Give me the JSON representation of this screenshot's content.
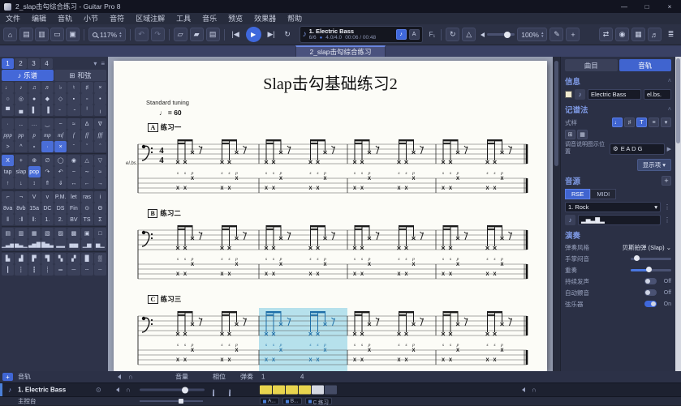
{
  "window": {
    "title": "2_slap击勾综合练习 - Guitar Pro 8",
    "min": "—",
    "max": "□",
    "close": "×"
  },
  "menu": {
    "items": [
      "文件",
      "编辑",
      "音轨",
      "小节",
      "音符",
      "区域注解",
      "工具",
      "音乐",
      "预览",
      "效果器",
      "帮助"
    ]
  },
  "toolbar": {
    "home": "⌂",
    "views": [
      "▤",
      "▥",
      "▭",
      "▣"
    ],
    "zoom": "117%",
    "up": "▴",
    "down": "▾",
    "undo": "↶",
    "redo": "↷",
    "doc1": "▱",
    "doc2": "▰",
    "print": "▤",
    "prev": "|◀",
    "play": "▶",
    "next": "▶|",
    "loop": "↻",
    "metronome": "△",
    "box": {
      "icon": "♪",
      "name": "1. Electric Bass",
      "pos": "6/6",
      "dot": "●",
      "sig": "4.0/4.0",
      "time": "00:06 / 00:48",
      "note_btn": "♪",
      "a_btn": "A"
    },
    "f1": "F₁",
    "vol": "100%",
    "pencil": "✎",
    "plus": "+",
    "right": [
      "⇄",
      "◉",
      "▦",
      "♬"
    ],
    "edge": "≣"
  },
  "tabbar": {
    "tab": "2_slap击勾综合练习"
  },
  "palette": {
    "tabs": [
      "1",
      "2",
      "3",
      "4"
    ],
    "caret": "▾",
    "menu_icon": "≡",
    "score_icon": "♪",
    "score_btn": "乐谱",
    "chord_icon": "⊞",
    "chord_btn": "和弦",
    "rows": [
      [
        "♩",
        "♪",
        "♫",
        "♬",
        "♭",
        "♮",
        "♯",
        "×"
      ],
      [
        "○",
        "◎",
        "●",
        "◆",
        "◇",
        "▪",
        "▫",
        "•"
      ],
      [
        "▀",
        "▄",
        "▌",
        "▐",
        "╴",
        "╶",
        "╵",
        "╷"
      ],
      [
        "·",
        "‥",
        "…",
        "‿",
        "~",
        "≈",
        "Δ",
        "∇"
      ],
      [
        "ppp",
        "pp",
        "p",
        "mp",
        "mf",
        "f",
        "ff",
        "fff"
      ],
      [
        ">",
        "^",
        "∘",
        "*·",
        "*×",
        "ˉ",
        "ˇ",
        "ˆ"
      ],
      [
        "*X",
        "+",
        "⊕",
        "∅",
        "◯",
        "◉",
        "△",
        "▽"
      ],
      [
        "tap",
        "slap",
        "*pop",
        "↷",
        "↶",
        "~",
        "∼",
        "≈"
      ],
      [
        "↑",
        "↓",
        "↕",
        "⇑",
        "⇓",
        "↔",
        "←",
        "→"
      ],
      [
        "⌐",
        "¬",
        "V",
        "v",
        "P.M.",
        "let",
        "ras",
        "i"
      ],
      [
        "8va",
        "8vb",
        "15a",
        "DC",
        "DS",
        "Fin",
        "⊙",
        "Θ"
      ],
      [
        "‖",
        ":‖",
        "‖:",
        "1.",
        "2.",
        "BV",
        "TS",
        "Σ"
      ],
      [
        "▤",
        "▥",
        "▦",
        "▧",
        "▨",
        "▩",
        "▣",
        "□"
      ],
      [
        "▁▃▅",
        "▅▃▁",
        "▃▅▇",
        "▇▅▃",
        "▂▂",
        "▅▅",
        "▁▅",
        "▅▁"
      ],
      [
        "▙",
        "▟",
        "▛",
        "▜",
        "▚",
        "▞",
        "█",
        "▒"
      ],
      [
        "┃",
        "┆",
        "┇",
        "┊",
        "═",
        "─",
        "┄",
        "┈"
      ]
    ]
  },
  "score": {
    "title": "Slap击勾基础练习2",
    "tuning": "Standard tuning",
    "tempo_note": "♩",
    "tempo_text": "= 60",
    "instrument": "el.bs.",
    "letters": [
      "S",
      "S",
      "P"
    ],
    "systems": [
      {
        "letter": "A",
        "name": "练习一",
        "measures": 4,
        "timesig": true,
        "highlight": []
      },
      {
        "letter": "B",
        "name": "练习二",
        "measures": 4,
        "timesig": false,
        "highlight": []
      },
      {
        "letter": "C",
        "name": "练习三",
        "measures": 4,
        "timesig": false,
        "highlight": [
          1
        ]
      }
    ]
  },
  "right_panel": {
    "tab_song": "曲目",
    "tab_track": "音轨",
    "info": {
      "header": "信息",
      "caret": "˄",
      "name": "Electric Bass",
      "short": "el.bs.",
      "icon": "♪"
    },
    "notation": {
      "header": "记谱法",
      "caret": "˄",
      "style": "式样",
      "style_btns": [
        "*♩",
        "♯",
        "*T",
        "≡",
        "▾"
      ],
      "extra_btns": [
        "⊞",
        "▦"
      ],
      "tuning_label": "调音说明图示位置",
      "gear": "⚙",
      "tuning": "E A D G",
      "arrow": "▶",
      "display": "显示项 ▾"
    },
    "audio": {
      "header": "音源",
      "plus": "+",
      "rse": "RSE",
      "midi": "MIDI",
      "bank": "1. Rock",
      "caret": "▾",
      "dots": "⋮",
      "wave": "▂▅▃▇▂",
      "wave_icon": "♪"
    },
    "play": {
      "header": "演奏",
      "style_label": "弹奏风格",
      "style_value": "贝斯拍弹 (Slap)",
      "caret": "⌄",
      "palm": "手掌闷音",
      "duet": "重奏",
      "sustain": "持续发声",
      "vibrato": "自动颤音",
      "strings": "弦乐器",
      "off": "Off",
      "on": "On"
    }
  },
  "mixer": {
    "plus": "+",
    "track_h": "音轨",
    "volume_h": "音量",
    "pan_h": "相位",
    "play_h": "弹奏",
    "n1": "1",
    "n4": "4",
    "track_icon": "♪",
    "track_name": "1. Electric Bass",
    "eye": "⊙",
    "hp": "∩",
    "master": "主控台",
    "cells": [
      "#e8d44e",
      "#e8d44e",
      "#e8d44e",
      "#e8d44e",
      "#d5d8e2",
      "#454c66"
    ],
    "markers": [
      "A...",
      "B...",
      "C 练习"
    ]
  },
  "colors": {
    "highlight": "#a9dcea",
    "note": "#1e6fa8",
    "accent": "#3f68dc"
  }
}
